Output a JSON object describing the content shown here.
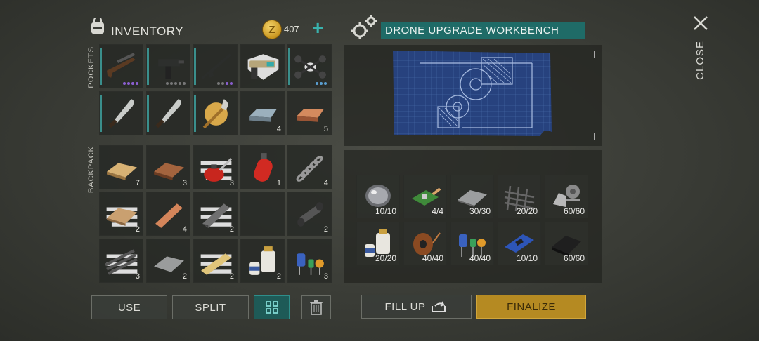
{
  "inventory": {
    "title": "INVENTORY",
    "coins": "407",
    "add_label": "+",
    "pockets_label": "POCKETS",
    "backpack_label": "BACKPACK",
    "pockets": [
      {
        "item": "shotgun-icon",
        "count": ""
      },
      {
        "item": "uzi-icon",
        "count": ""
      },
      {
        "item": "rifle-icon",
        "count": ""
      },
      {
        "item": "pistol-icon",
        "count": ""
      },
      {
        "item": "drone-icon",
        "count": ""
      },
      {
        "item": "machete-icon",
        "count": ""
      },
      {
        "item": "machete-icon",
        "count": ""
      },
      {
        "item": "glaive-icon",
        "count": ""
      },
      {
        "item": "iron-ingot-icon",
        "count": "4"
      },
      {
        "item": "copper-ingot-icon",
        "count": "5"
      }
    ],
    "backpack": [
      {
        "item": "plank-icon",
        "count": "7"
      },
      {
        "item": "wood-board-icon",
        "count": "3"
      },
      {
        "item": "oil-can-icon",
        "count": "3"
      },
      {
        "item": "gas-canister-icon",
        "count": "1"
      },
      {
        "item": "spring-icon",
        "count": "4"
      },
      {
        "item": "plywood-icon",
        "count": "2"
      },
      {
        "item": "copper-bar-icon",
        "count": "4"
      },
      {
        "item": "steel-bar-icon",
        "count": "2"
      },
      {
        "item": "empty",
        "count": ""
      },
      {
        "item": "pipe-icon",
        "count": "2"
      },
      {
        "item": "rebar-icon",
        "count": "3"
      },
      {
        "item": "metal-plate-icon",
        "count": "2"
      },
      {
        "item": "wood-beam-icon",
        "count": "2"
      },
      {
        "item": "resin-icon",
        "count": "2"
      },
      {
        "item": "electronics-icon",
        "count": "3"
      }
    ],
    "buttons": {
      "use": "USE",
      "split": "SPLIT"
    }
  },
  "workbench": {
    "title": "DRONE UPGRADE WORKBENCH",
    "materials": [
      {
        "item": "lens-icon",
        "count": "10/10"
      },
      {
        "item": "circuit-board-icon",
        "count": "4/4"
      },
      {
        "item": "metal-sheet-icon",
        "count": "30/30"
      },
      {
        "item": "rebar-mesh-icon",
        "count": "20/20"
      },
      {
        "item": "gear-part-icon",
        "count": "60/60"
      },
      {
        "item": "resin-icon",
        "count": "20/20"
      },
      {
        "item": "copper-wire-icon",
        "count": "40/40"
      },
      {
        "item": "capacitors-icon",
        "count": "40/40"
      },
      {
        "item": "microchip-board-icon",
        "count": "10/10"
      },
      {
        "item": "rubber-icon",
        "count": "60/60"
      }
    ],
    "buttons": {
      "fill_up": "FILL UP",
      "finalize": "FINALIZE"
    }
  },
  "close_label": "CLOSE"
}
